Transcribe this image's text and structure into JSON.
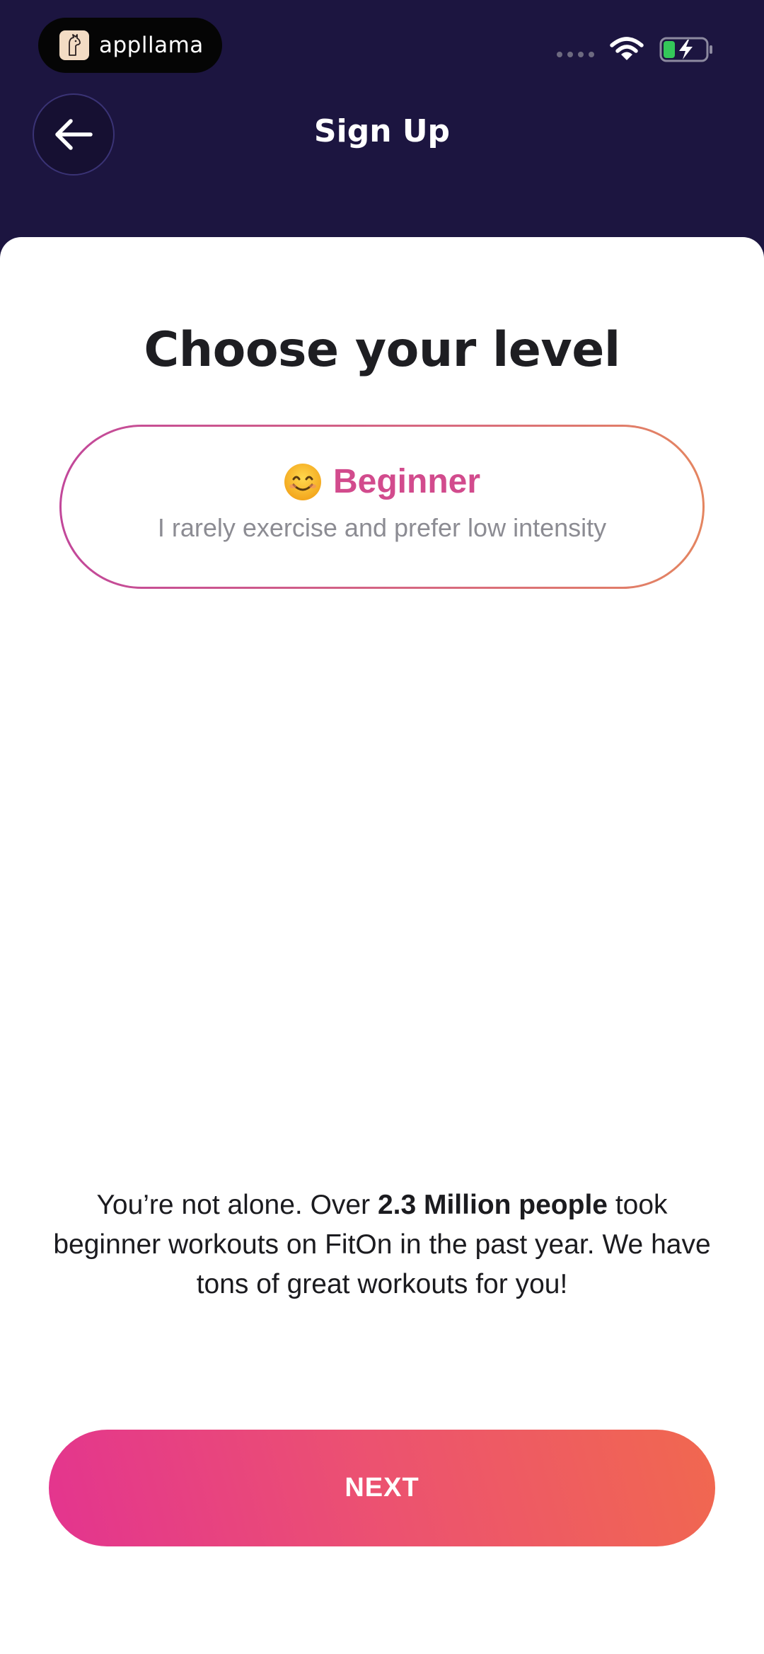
{
  "status_bar": {
    "app_badge": "appllama",
    "icons": [
      "cellular-signal-icon",
      "wifi-icon",
      "battery-charging-icon"
    ]
  },
  "header": {
    "title": "Sign Up",
    "back_icon": "arrow-left-icon"
  },
  "main": {
    "title": "Choose your  level",
    "selected_level": {
      "emoji": "smiling-face-icon",
      "name": "Beginner",
      "description": "I rarely exercise and prefer low intensity"
    },
    "info": {
      "prefix": "You’re not alone. Over ",
      "highlight": "2.3 Million people",
      "suffix": " took beginner workouts on FitOn in the past year. We have tons of great workouts for you!"
    },
    "next_label": "NEXT"
  },
  "colors": {
    "header_bg": "#1c1540",
    "accent_pink": "#d24b8d",
    "button_gradient_start": "#e3348f",
    "button_gradient_end": "#f1684f"
  }
}
